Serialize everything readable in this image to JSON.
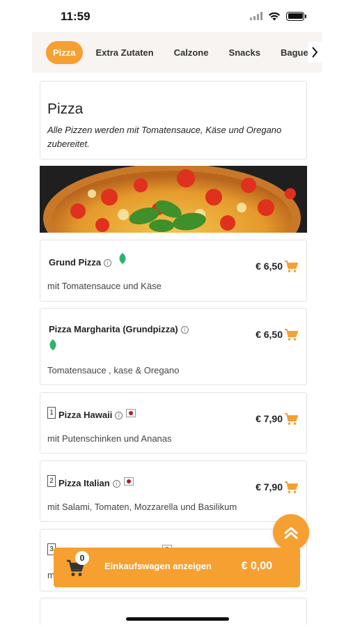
{
  "status": {
    "time": "11:59"
  },
  "tabs": [
    {
      "label": "Pizza",
      "active": true
    },
    {
      "label": "Extra Zutaten",
      "active": false
    },
    {
      "label": "Calzone",
      "active": false
    },
    {
      "label": "Snacks",
      "active": false
    },
    {
      "label": "Baguette",
      "active": false
    }
  ],
  "category": {
    "title": "Pizza",
    "description": "Alle Pizzen werden mit Tomatensauce, Käse und Oregano zubereitet."
  },
  "items": [
    {
      "name": "Grund Pizza",
      "description": "mit Tomatensauce und Käse",
      "price": "€ 6,50",
      "vegetarian": true
    },
    {
      "name": "Pizza Margharita (Grundpizza)",
      "description": "Tomatensauce , kase & Oregano",
      "price": "€ 6,50",
      "vegetarian": true
    },
    {
      "number": "1",
      "name": "Pizza Hawaii",
      "description": "mit Putenschinken und Ananas",
      "price": "€ 7,90"
    },
    {
      "number": "2",
      "name": "Pizza Italian",
      "description": "mit Salami, Tomaten, Mozzarella und Basilikum",
      "price": "€ 7,90"
    },
    {
      "number": "3",
      "description_partial": "m"
    }
  ],
  "cart": {
    "count": "0",
    "label": "Einkaufswagen anzeigen",
    "total": "€ 0,00"
  },
  "colors": {
    "accent": "#f5a031",
    "flag_dot": "#b3182d",
    "leaf": "#2db36b"
  },
  "icons": [
    "chevron-right-icon",
    "info-icon",
    "leaf-icon",
    "flag-icon",
    "cart-icon",
    "double-chevron-up-icon"
  ]
}
